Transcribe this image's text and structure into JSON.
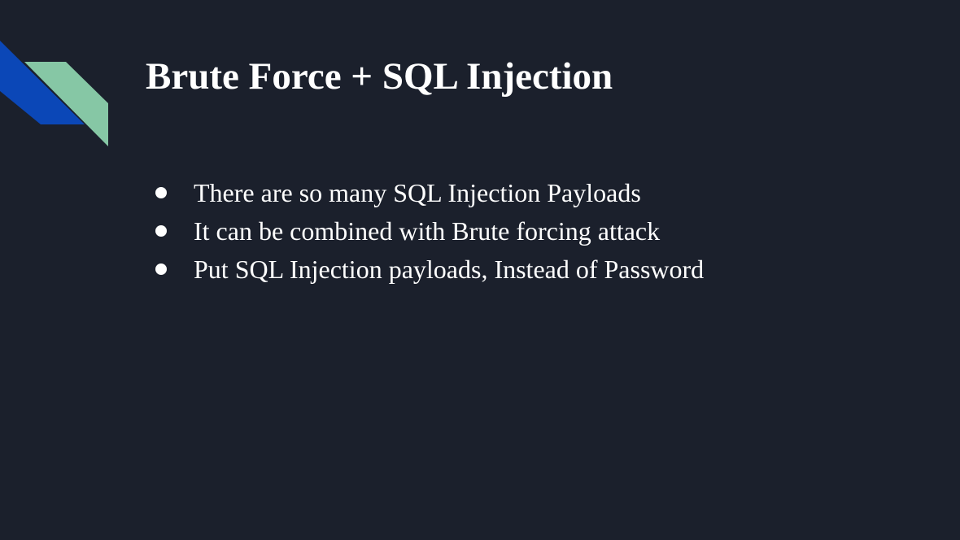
{
  "slide": {
    "title": "Brute Force + SQL Injection",
    "bullets": [
      "There are so many SQL Injection Payloads",
      "It can be combined with Brute forcing attack",
      "Put SQL Injection payloads, Instead of Password"
    ]
  },
  "colors": {
    "background": "#1b202c",
    "accent_blue": "#0b47b7",
    "accent_green": "#86c7a5",
    "text": "#ffffff"
  }
}
